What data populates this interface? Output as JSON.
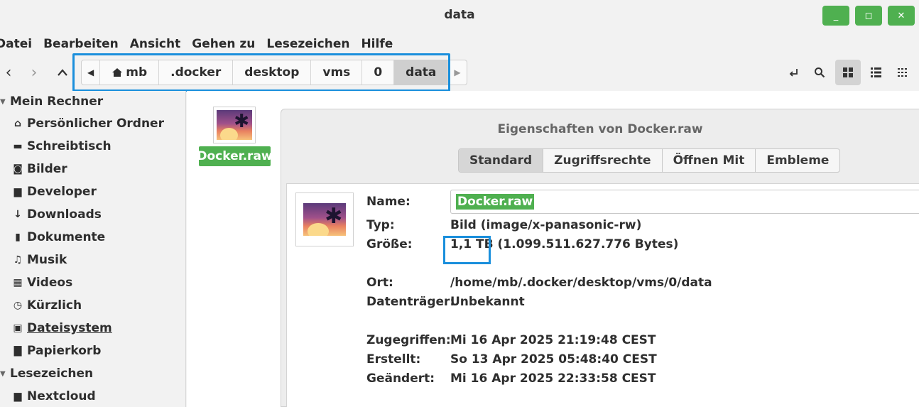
{
  "window": {
    "title": "data",
    "minimize_label": "_",
    "maximize_label": "◻",
    "close_label": "✕"
  },
  "menu": [
    "Datei",
    "Bearbeiten",
    "Ansicht",
    "Gehen zu",
    "Lesezeichen",
    "Hilfe"
  ],
  "pathbar": {
    "home_icon": "home-icon",
    "crumbs": [
      "mb",
      ".docker",
      "desktop",
      "vms",
      "0",
      "data"
    ],
    "current": "data"
  },
  "toolbar": {
    "back_icon": "chevron-left-icon",
    "forward_icon": "chevron-right-icon",
    "up_icon": "chevron-up-icon",
    "location_icon": "location-toggle-icon",
    "search_icon": "search-icon",
    "icon_view_icon": "grid-view-icon",
    "list_view_icon": "list-view-icon",
    "compact_view_icon": "compact-view-icon"
  },
  "sidebar": {
    "section_computer": "Mein Rechner",
    "computer_items": [
      {
        "label": "Persönlicher Ordner",
        "icon": "home-icon"
      },
      {
        "label": "Schreibtisch",
        "icon": "desktop-icon"
      },
      {
        "label": "Bilder",
        "icon": "camera-icon"
      },
      {
        "label": "Developer",
        "icon": "folder-icon"
      },
      {
        "label": "Downloads",
        "icon": "download-icon"
      },
      {
        "label": "Dokumente",
        "icon": "document-icon"
      },
      {
        "label": "Musik",
        "icon": "music-icon"
      },
      {
        "label": "Videos",
        "icon": "film-icon"
      },
      {
        "label": "Kürzlich",
        "icon": "clock-icon"
      },
      {
        "label": "Dateisystem",
        "icon": "drive-icon"
      },
      {
        "label": "Papierkorb",
        "icon": "trash-icon"
      }
    ],
    "section_bookmarks": "Lesezeichen",
    "bookmark_items": [
      {
        "label": "Nextcloud",
        "icon": "folder-icon"
      }
    ]
  },
  "files": [
    {
      "name": "Docker.raw",
      "icon": "image-file-icon",
      "selected": true
    }
  ],
  "dialog": {
    "title": "Eigenschaften von Docker.raw",
    "tabs": [
      "Standard",
      "Zugriffsrechte",
      "Öffnen Mit",
      "Embleme"
    ],
    "active_tab": "Standard",
    "labels": {
      "name": "Name:",
      "type": "Typ:",
      "size": "Größe:",
      "location": "Ort:",
      "volume": "Datenträger:",
      "accessed": "Zugegriffen:",
      "created": "Erstellt:",
      "modified": "Geändert:"
    },
    "values": {
      "name": "Docker.raw",
      "type": "Bild (image/x-panasonic-rw)",
      "size_short": "1,1 TB",
      "size_bytes": "(1.099.511.627.776 Bytes)",
      "location": "/home/mb/.docker/desktop/vms/0/data",
      "volume": "Unbekannt",
      "accessed": "Mi 16 Apr 2025 21:19:48 CEST",
      "created": "So 13 Apr 2025 05:48:40 CEST",
      "modified": "Mi 16 Apr 2025 22:33:58 CEST"
    }
  },
  "colors": {
    "accent": "#4fb050",
    "highlight": "#1a8fdc"
  }
}
